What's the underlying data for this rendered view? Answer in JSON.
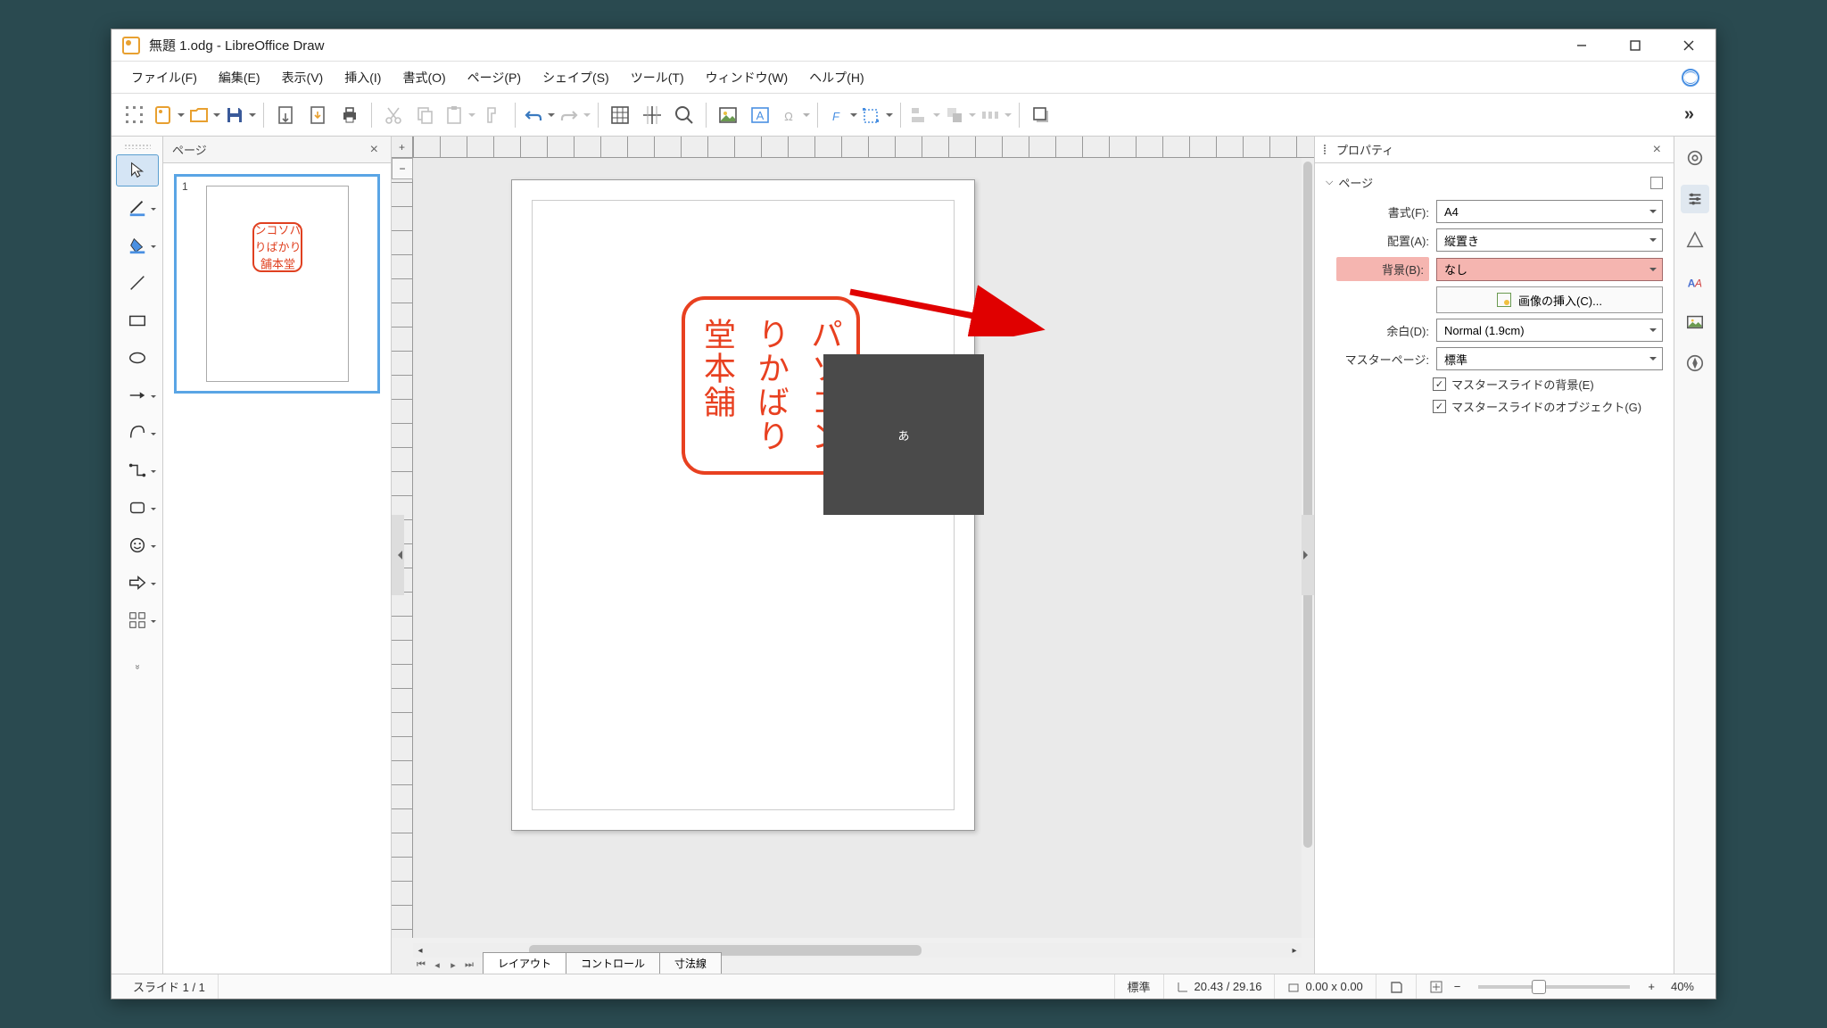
{
  "window": {
    "title": "無題 1.odg - LibreOffice Draw"
  },
  "menu": {
    "file": "ファイル(F)",
    "edit": "編集(E)",
    "view": "表示(V)",
    "insert": "挿入(I)",
    "format": "書式(O)",
    "page": "ページ(P)",
    "shape": "シェイプ(S)",
    "tools": "ツール(T)",
    "window": "ウィンドウ(W)",
    "help": "ヘルプ(H)"
  },
  "panels": {
    "pages": "ページ",
    "properties": "プロパティ"
  },
  "thumb": {
    "number": "1"
  },
  "stamp": {
    "col1": "パソコン",
    "col2": "りかばり",
    "col3": "堂本舗"
  },
  "ime": {
    "char": "あ"
  },
  "tabs": {
    "layout": "レイアウト",
    "control": "コントロール",
    "dim": "寸法線"
  },
  "props": {
    "section": "ページ",
    "format_label": "書式(F):",
    "format_value": "A4",
    "orient_label": "配置(A):",
    "orient_value": "縦置き",
    "bg_label": "背景(B):",
    "bg_value": "なし",
    "insert_image": "画像の挿入(C)...",
    "margin_label": "余白(D):",
    "margin_value": "Normal (1.9cm)",
    "master_label": "マスターページ:",
    "master_value": "標準",
    "master_bg": "マスタースライドの背景(E)",
    "master_obj": "マスタースライドのオブジェクト(G)"
  },
  "status": {
    "slide": "スライド 1 / 1",
    "std": "標準",
    "coord": "20.43 / 29.16",
    "size": "0.00 x 0.00",
    "zoom": "40%"
  }
}
